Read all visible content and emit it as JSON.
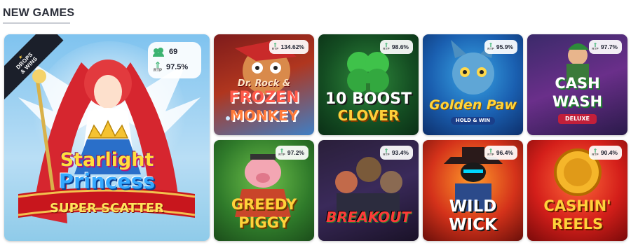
{
  "section": {
    "title": "NEW GAMES"
  },
  "featured": {
    "ribbon_line1": "DROPS",
    "ribbon_line2": "& WINS",
    "players": "69",
    "rtp_label": "RTP",
    "rtp": "97.5%",
    "title_line1": "Starlight",
    "title_line2": "Princess",
    "title_line3": "SUPER SCATTER"
  },
  "games": [
    {
      "line1": "Dr. Rock &",
      "line2": "FROZEN",
      "line3": "MONKEY",
      "rtp": "134.62%",
      "rtp_label": "RTP"
    },
    {
      "line1": "10 BOOST",
      "line2": "CLOVER",
      "line3": "",
      "rtp": "98.6%",
      "rtp_label": "RTP"
    },
    {
      "line1": "Golden Paw",
      "line2": "HOLD & WIN",
      "line3": "",
      "rtp": "95.9%",
      "rtp_label": "RTP"
    },
    {
      "line1": "CASH",
      "line2": "WASH",
      "line3": "DELUXE",
      "rtp": "97.7%",
      "rtp_label": "RTP"
    },
    {
      "line1": "GREEDY",
      "line2": "PIGGY",
      "line3": "",
      "rtp": "97.2%",
      "rtp_label": "RTP"
    },
    {
      "line1": "BREAKOUT",
      "line2": "",
      "line3": "",
      "rtp": "93.4%",
      "rtp_label": "RTP"
    },
    {
      "line1": "WILD",
      "line2": "WICK",
      "line3": "",
      "rtp": "96.4%",
      "rtp_label": "RTP"
    },
    {
      "line1": "CASHIN'",
      "line2": "REELS",
      "line3": "",
      "rtp": "90.4%",
      "rtp_label": "RTP"
    }
  ]
}
